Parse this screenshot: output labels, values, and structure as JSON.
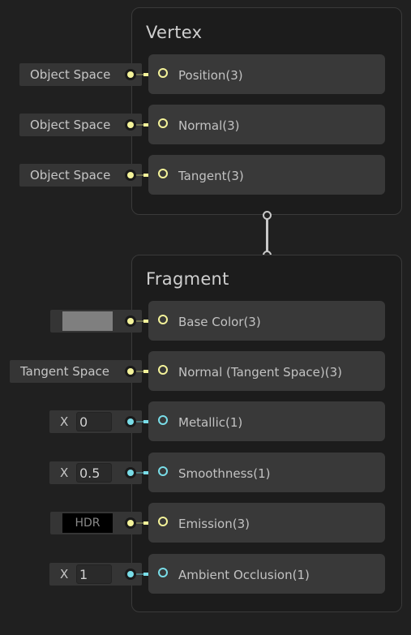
{
  "colors": {
    "vector3_port": "#f4f39a",
    "float_port": "#79dde8",
    "background": "#202020",
    "block_bg": "#393939"
  },
  "contexts": {
    "vertex": {
      "title": "Vertex",
      "blocks": [
        {
          "label": "Position(3)",
          "type": "vector3",
          "input": {
            "kind": "dropdown",
            "value": "Object Space"
          }
        },
        {
          "label": "Normal(3)",
          "type": "vector3",
          "input": {
            "kind": "dropdown",
            "value": "Object Space"
          }
        },
        {
          "label": "Tangent(3)",
          "type": "vector3",
          "input": {
            "kind": "dropdown",
            "value": "Object Space"
          }
        }
      ]
    },
    "fragment": {
      "title": "Fragment",
      "blocks": [
        {
          "label": "Base Color(3)",
          "type": "vector3",
          "input": {
            "kind": "color",
            "value": "#7f7f7f"
          }
        },
        {
          "label": "Normal (Tangent Space)(3)",
          "type": "vector3",
          "input": {
            "kind": "dropdown",
            "value": "Tangent Space"
          }
        },
        {
          "label": "Metallic(1)",
          "type": "float",
          "input": {
            "kind": "float",
            "axis": "X",
            "value": "0"
          }
        },
        {
          "label": "Smoothness(1)",
          "type": "float",
          "input": {
            "kind": "float",
            "axis": "X",
            "value": "0.5"
          }
        },
        {
          "label": "Emission(3)",
          "type": "vector3",
          "input": {
            "kind": "hdr-color",
            "value": "HDR",
            "color": "#000000"
          }
        },
        {
          "label": "Ambient Occlusion(1)",
          "type": "float",
          "input": {
            "kind": "float",
            "axis": "X",
            "value": "1"
          }
        }
      ]
    }
  }
}
